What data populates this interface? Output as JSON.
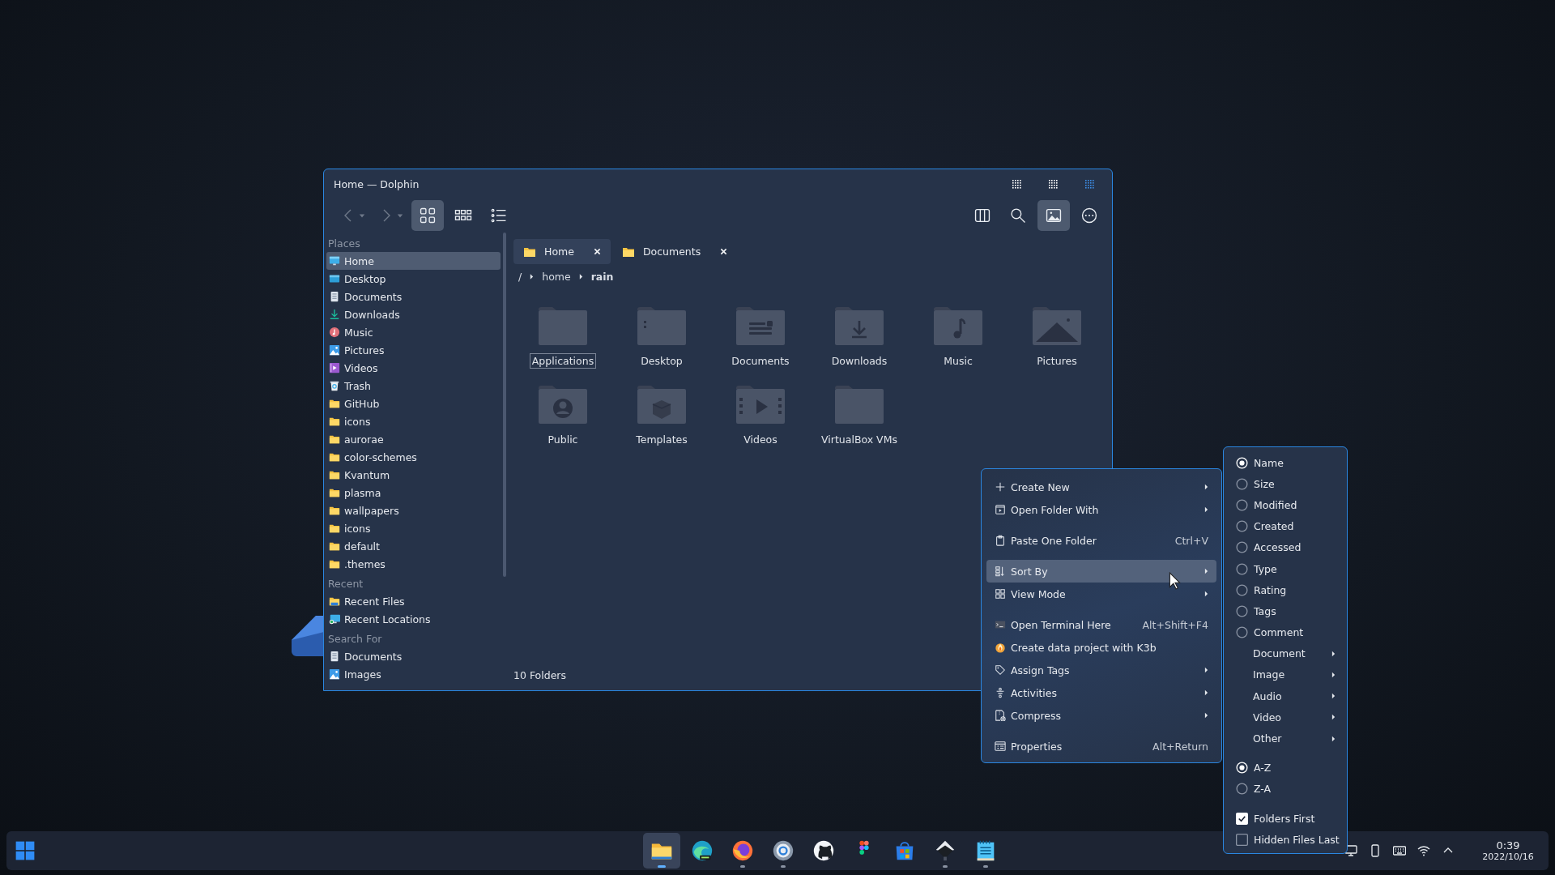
{
  "window": {
    "title": "Home — Dolphin",
    "buttons": [
      {
        "kind": "minimize"
      },
      {
        "kind": "maximize"
      },
      {
        "kind": "close"
      }
    ]
  },
  "toolbar": {
    "nav": [
      {
        "kind": "back",
        "disabled": true
      },
      {
        "kind": "forward",
        "disabled": true
      }
    ],
    "view_modes": [
      {
        "kind": "icons",
        "selected": true
      },
      {
        "kind": "compact",
        "selected": false
      },
      {
        "kind": "details",
        "selected": false
      }
    ],
    "actions": [
      {
        "kind": "split",
        "selected": false
      },
      {
        "kind": "search",
        "selected": false
      },
      {
        "kind": "preview",
        "selected": true
      },
      {
        "kind": "more",
        "selected": false
      }
    ]
  },
  "sidebar": {
    "sections": [
      {
        "title": "Places",
        "items": [
          {
            "label": "Home",
            "kind": "monitor",
            "selected": true
          },
          {
            "label": "Desktop",
            "kind": "desktop",
            "selected": false
          },
          {
            "label": "Documents",
            "kind": "document",
            "selected": false
          },
          {
            "label": "Downloads",
            "kind": "download",
            "selected": false
          },
          {
            "label": "Music",
            "kind": "music",
            "selected": false
          },
          {
            "label": "Pictures",
            "kind": "picture",
            "selected": false
          },
          {
            "label": "Videos",
            "kind": "video",
            "selected": false
          },
          {
            "label": "Trash",
            "kind": "trash",
            "selected": false
          },
          {
            "label": "GitHub",
            "kind": "folder",
            "selected": false
          },
          {
            "label": "icons",
            "kind": "folder",
            "selected": false
          },
          {
            "label": "aurorae",
            "kind": "folder",
            "selected": false
          },
          {
            "label": "color-schemes",
            "kind": "folder",
            "selected": false
          },
          {
            "label": "Kvantum",
            "kind": "folder",
            "selected": false
          },
          {
            "label": "plasma",
            "kind": "folder",
            "selected": false
          },
          {
            "label": "wallpapers",
            "kind": "folder",
            "selected": false
          },
          {
            "label": "icons",
            "kind": "folder",
            "selected": false
          },
          {
            "label": "default",
            "kind": "folder",
            "selected": false
          },
          {
            "label": ".themes",
            "kind": "folder",
            "selected": false
          }
        ]
      },
      {
        "title": "Recent",
        "items": [
          {
            "label": "Recent Files",
            "kind": "recent-files",
            "selected": false
          },
          {
            "label": "Recent Locations",
            "kind": "recent-locations",
            "selected": false
          }
        ]
      },
      {
        "title": "Search For",
        "items": [
          {
            "label": "Documents",
            "kind": "document",
            "selected": false
          },
          {
            "label": "Images",
            "kind": "picture",
            "selected": false
          }
        ]
      }
    ]
  },
  "tabs": [
    {
      "label": "Home",
      "selected": true
    },
    {
      "label": "Documents",
      "selected": false
    }
  ],
  "breadcrumb": [
    "/",
    "home",
    "rain"
  ],
  "folders": [
    {
      "name": "Applications",
      "kind": "plain",
      "focused": true
    },
    {
      "name": "Desktop",
      "kind": "desktop",
      "focused": false
    },
    {
      "name": "Documents",
      "kind": "document",
      "focused": false
    },
    {
      "name": "Downloads",
      "kind": "download",
      "focused": false
    },
    {
      "name": "Music",
      "kind": "music",
      "focused": false
    },
    {
      "name": "Pictures",
      "kind": "picture",
      "focused": false
    },
    {
      "name": "Public",
      "kind": "user",
      "focused": false
    },
    {
      "name": "Templates",
      "kind": "package",
      "focused": false
    },
    {
      "name": "Videos",
      "kind": "video",
      "focused": false
    },
    {
      "name": "VirtualBox VMs",
      "kind": "plain",
      "focused": false
    }
  ],
  "status_bar": "10 Folders",
  "context_menu": [
    [
      {
        "kind": "plus",
        "label": "Create New",
        "submenu": true,
        "selected": false
      },
      {
        "kind": "play-box",
        "label": "Open Folder With",
        "submenu": true,
        "selected": false
      }
    ],
    [
      {
        "kind": "clipboard",
        "label": "Paste One Folder",
        "shortcut": "Ctrl+V",
        "submenu": false,
        "selected": false
      }
    ],
    [
      {
        "kind": "sort",
        "label": "Sort By",
        "submenu": true,
        "selected": true
      },
      {
        "kind": "grid",
        "label": "View Mode",
        "submenu": true,
        "selected": false
      }
    ],
    [
      {
        "kind": "terminal",
        "label": "Open Terminal Here",
        "shortcut": "Alt+Shift+F4",
        "submenu": false,
        "selected": false
      },
      {
        "kind": "flame",
        "label": "Create data project with K3b",
        "submenu": false,
        "selected": false
      },
      {
        "kind": "tag",
        "label": "Assign Tags",
        "submenu": true,
        "selected": false
      },
      {
        "kind": "activities",
        "label": "Activities",
        "submenu": true,
        "selected": false
      },
      {
        "kind": "compress",
        "label": "Compress",
        "submenu": true,
        "selected": false
      }
    ],
    [
      {
        "kind": "properties",
        "label": "Properties",
        "shortcut": "Alt+Return",
        "submenu": false,
        "selected": false
      }
    ]
  ],
  "sort_menu": [
    [
      {
        "kind": "radio",
        "label": "Name",
        "checked": true
      },
      {
        "kind": "radio",
        "label": "Size",
        "checked": false
      },
      {
        "kind": "radio",
        "label": "Modified",
        "checked": false
      },
      {
        "kind": "radio",
        "label": "Created",
        "checked": false
      },
      {
        "kind": "radio",
        "label": "Accessed",
        "checked": false
      },
      {
        "kind": "radio",
        "label": "Type",
        "checked": false
      },
      {
        "kind": "radio",
        "label": "Rating",
        "checked": false
      },
      {
        "kind": "radio",
        "label": "Tags",
        "checked": false
      },
      {
        "kind": "radio",
        "label": "Comment",
        "checked": false
      },
      {
        "kind": "submenu",
        "label": "Document"
      },
      {
        "kind": "submenu",
        "label": "Image"
      },
      {
        "kind": "submenu",
        "label": "Audio"
      },
      {
        "kind": "submenu",
        "label": "Video"
      },
      {
        "kind": "submenu",
        "label": "Other"
      }
    ],
    [
      {
        "kind": "radio",
        "label": "A-Z",
        "checked": true
      },
      {
        "kind": "radio",
        "label": "Z-A",
        "checked": false
      }
    ],
    [
      {
        "kind": "checkbox",
        "label": "Folders First",
        "checked": true
      },
      {
        "kind": "checkbox",
        "label": "Hidden Files Last",
        "checked": false
      }
    ]
  ],
  "taskbar": {
    "apps": [
      {
        "kind": "files",
        "active": true,
        "running": true
      },
      {
        "kind": "browser-wave",
        "active": false,
        "running": false
      },
      {
        "kind": "browser-fox",
        "active": false,
        "running": true
      },
      {
        "kind": "settings",
        "active": false,
        "running": true
      },
      {
        "kind": "cat",
        "active": false,
        "running": false
      },
      {
        "kind": "design",
        "active": false,
        "running": false
      },
      {
        "kind": "store",
        "active": false,
        "running": false
      },
      {
        "kind": "pen",
        "active": false,
        "running": true
      },
      {
        "kind": "notes",
        "active": false,
        "running": true
      }
    ],
    "tray": [
      {
        "kind": "monitor"
      },
      {
        "kind": "phone"
      },
      {
        "kind": "keyboard"
      },
      {
        "kind": "wifi"
      },
      {
        "kind": "chevron"
      }
    ],
    "time": "0:39",
    "date": "2022/10/16"
  }
}
